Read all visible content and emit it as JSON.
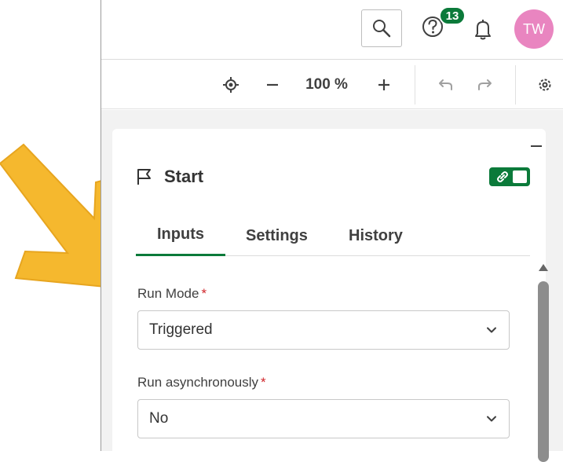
{
  "header": {
    "notification_count": "13",
    "user_initials": "TW"
  },
  "toolbar": {
    "zoom_level": "100 %"
  },
  "panel": {
    "title": "Start",
    "tabs": [
      {
        "label": "Inputs",
        "active": true
      },
      {
        "label": "Settings",
        "active": false
      },
      {
        "label": "History",
        "active": false
      }
    ],
    "fields": [
      {
        "label": "Run Mode",
        "required_marker": "*",
        "value": "Triggered"
      },
      {
        "label": "Run asynchronously",
        "required_marker": "*",
        "value": "No"
      }
    ]
  },
  "icons": [
    "search-icon",
    "help-icon",
    "bell-icon",
    "locate-icon",
    "zoom-out-icon",
    "zoom-in-icon",
    "undo-icon",
    "redo-icon",
    "settings-icon",
    "flag-icon",
    "link-icon",
    "chevron-down-icon"
  ],
  "colors": {
    "accent_green": "#0b7a3a",
    "avatar_pink": "#e985c0",
    "required_red": "#d0262b",
    "callout_arrow": "#f5b82e"
  }
}
